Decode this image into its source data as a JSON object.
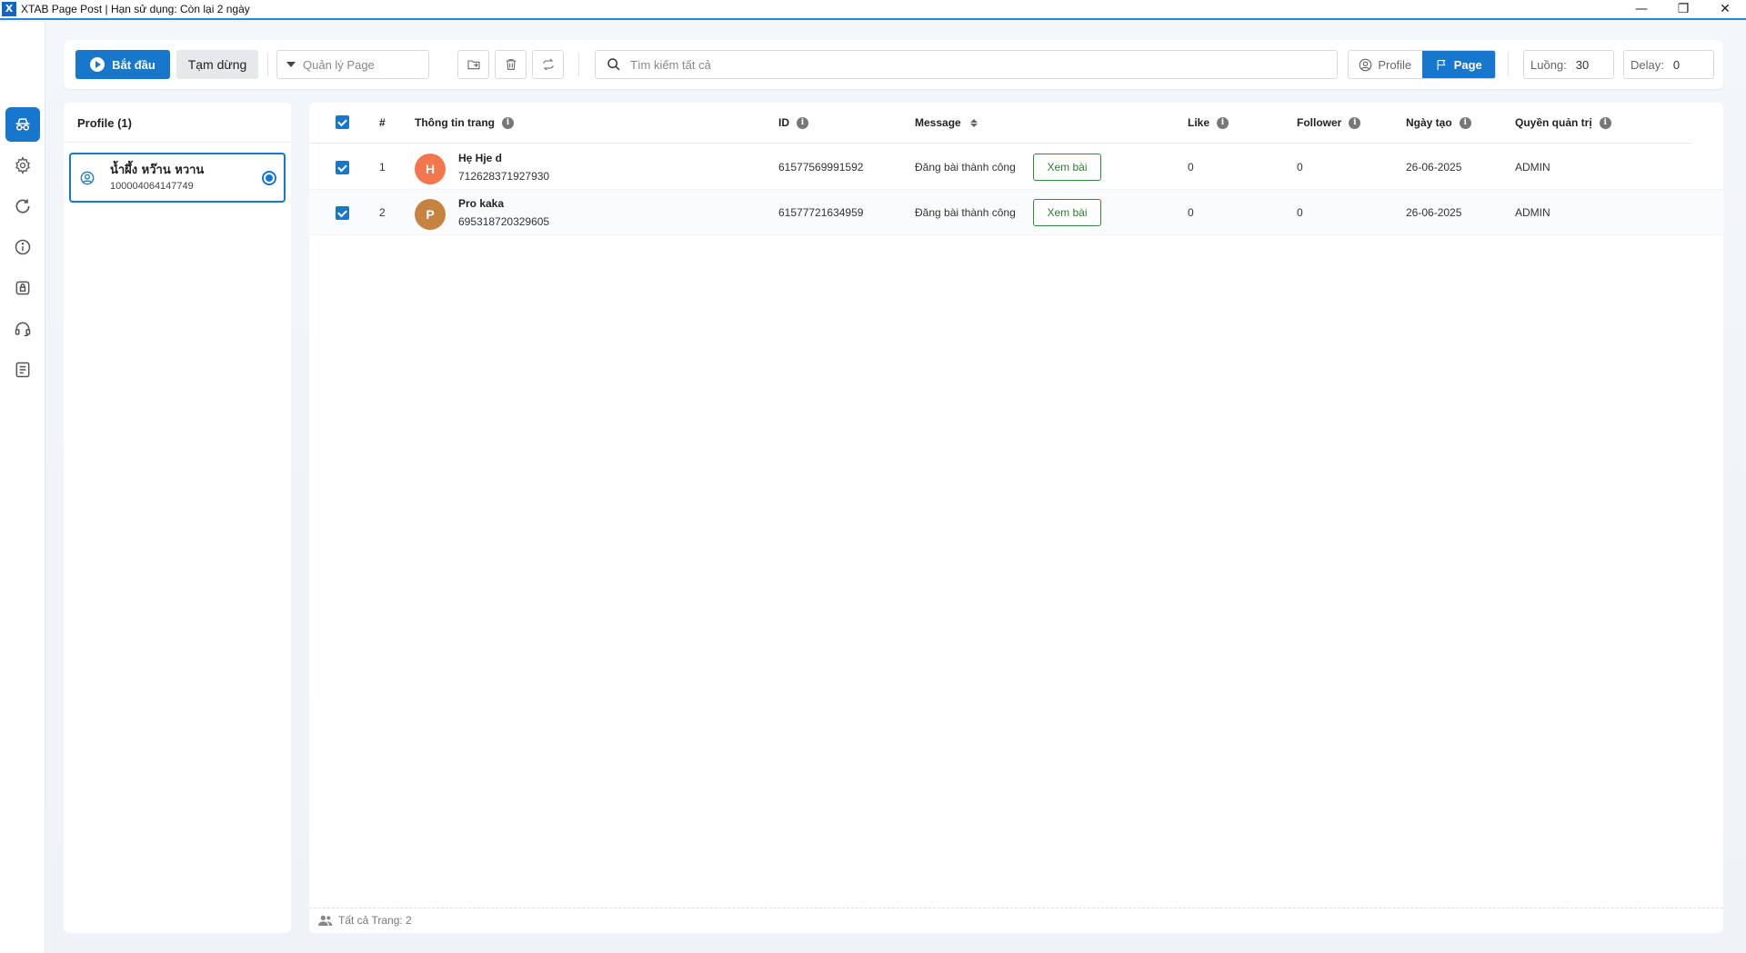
{
  "window": {
    "title": "XTAB Page Post | Hạn sử dụng: Còn lại 2 ngày",
    "app_icon": "X",
    "minimize": "—",
    "restore": "❐",
    "close": "✕"
  },
  "rail": {
    "items": [
      {
        "icon": "spy-icon",
        "active": true
      },
      {
        "icon": "gear-icon",
        "active": false
      },
      {
        "icon": "refresh-icon",
        "active": false
      },
      {
        "icon": "info-icon",
        "active": false
      },
      {
        "icon": "lock-icon",
        "active": false
      },
      {
        "icon": "headset-icon",
        "active": false
      },
      {
        "icon": "notes-icon",
        "active": false
      }
    ]
  },
  "toolbar": {
    "start_label": "Bắt đầu",
    "pause_label": "Tạm dừng",
    "page_select_placeholder": "Quản lý Page",
    "search_placeholder": "Tìm kiếm tất cả",
    "toggle_profile": "Profile",
    "toggle_page": "Page",
    "threads_label": "Luồng:",
    "threads_value": "30",
    "delay_label": "Delay:",
    "delay_value": "0"
  },
  "profiles": {
    "header": "Profile (1)",
    "items": [
      {
        "name": "น้ำผึ้ง หว๊าน หวาน",
        "id": "100004064147749",
        "selected": true
      }
    ]
  },
  "table": {
    "columns": {
      "index": "#",
      "page_info": "Thông tin trang",
      "id": "ID",
      "message": "Message",
      "like": "Like",
      "follower": "Follower",
      "created": "Ngày tạo",
      "admin": "Quyền quản trị"
    },
    "rows": [
      {
        "index": "1",
        "avatar_letter": "H",
        "avatar_color": "#f4764d",
        "name": "Hẹ Hje d",
        "page_id": "712628371927930",
        "id": "61577569991592",
        "message": "Đăng bài thành công",
        "action": "Xem bài",
        "like": "0",
        "follower": "0",
        "created": "26-06-2025",
        "admin": "ADMIN"
      },
      {
        "index": "2",
        "avatar_letter": "P",
        "avatar_color": "#c8823f",
        "name": "Pro kaka",
        "page_id": "695318720329605",
        "id": "61577721634959",
        "message": "Đăng bài thành công",
        "action": "Xem bài",
        "like": "0",
        "follower": "0",
        "created": "26-06-2025",
        "admin": "ADMIN"
      }
    ],
    "footer": "Tất cả Trang: 2"
  },
  "colors": {
    "accent": "#1677cc",
    "success": "#2e7d32"
  }
}
